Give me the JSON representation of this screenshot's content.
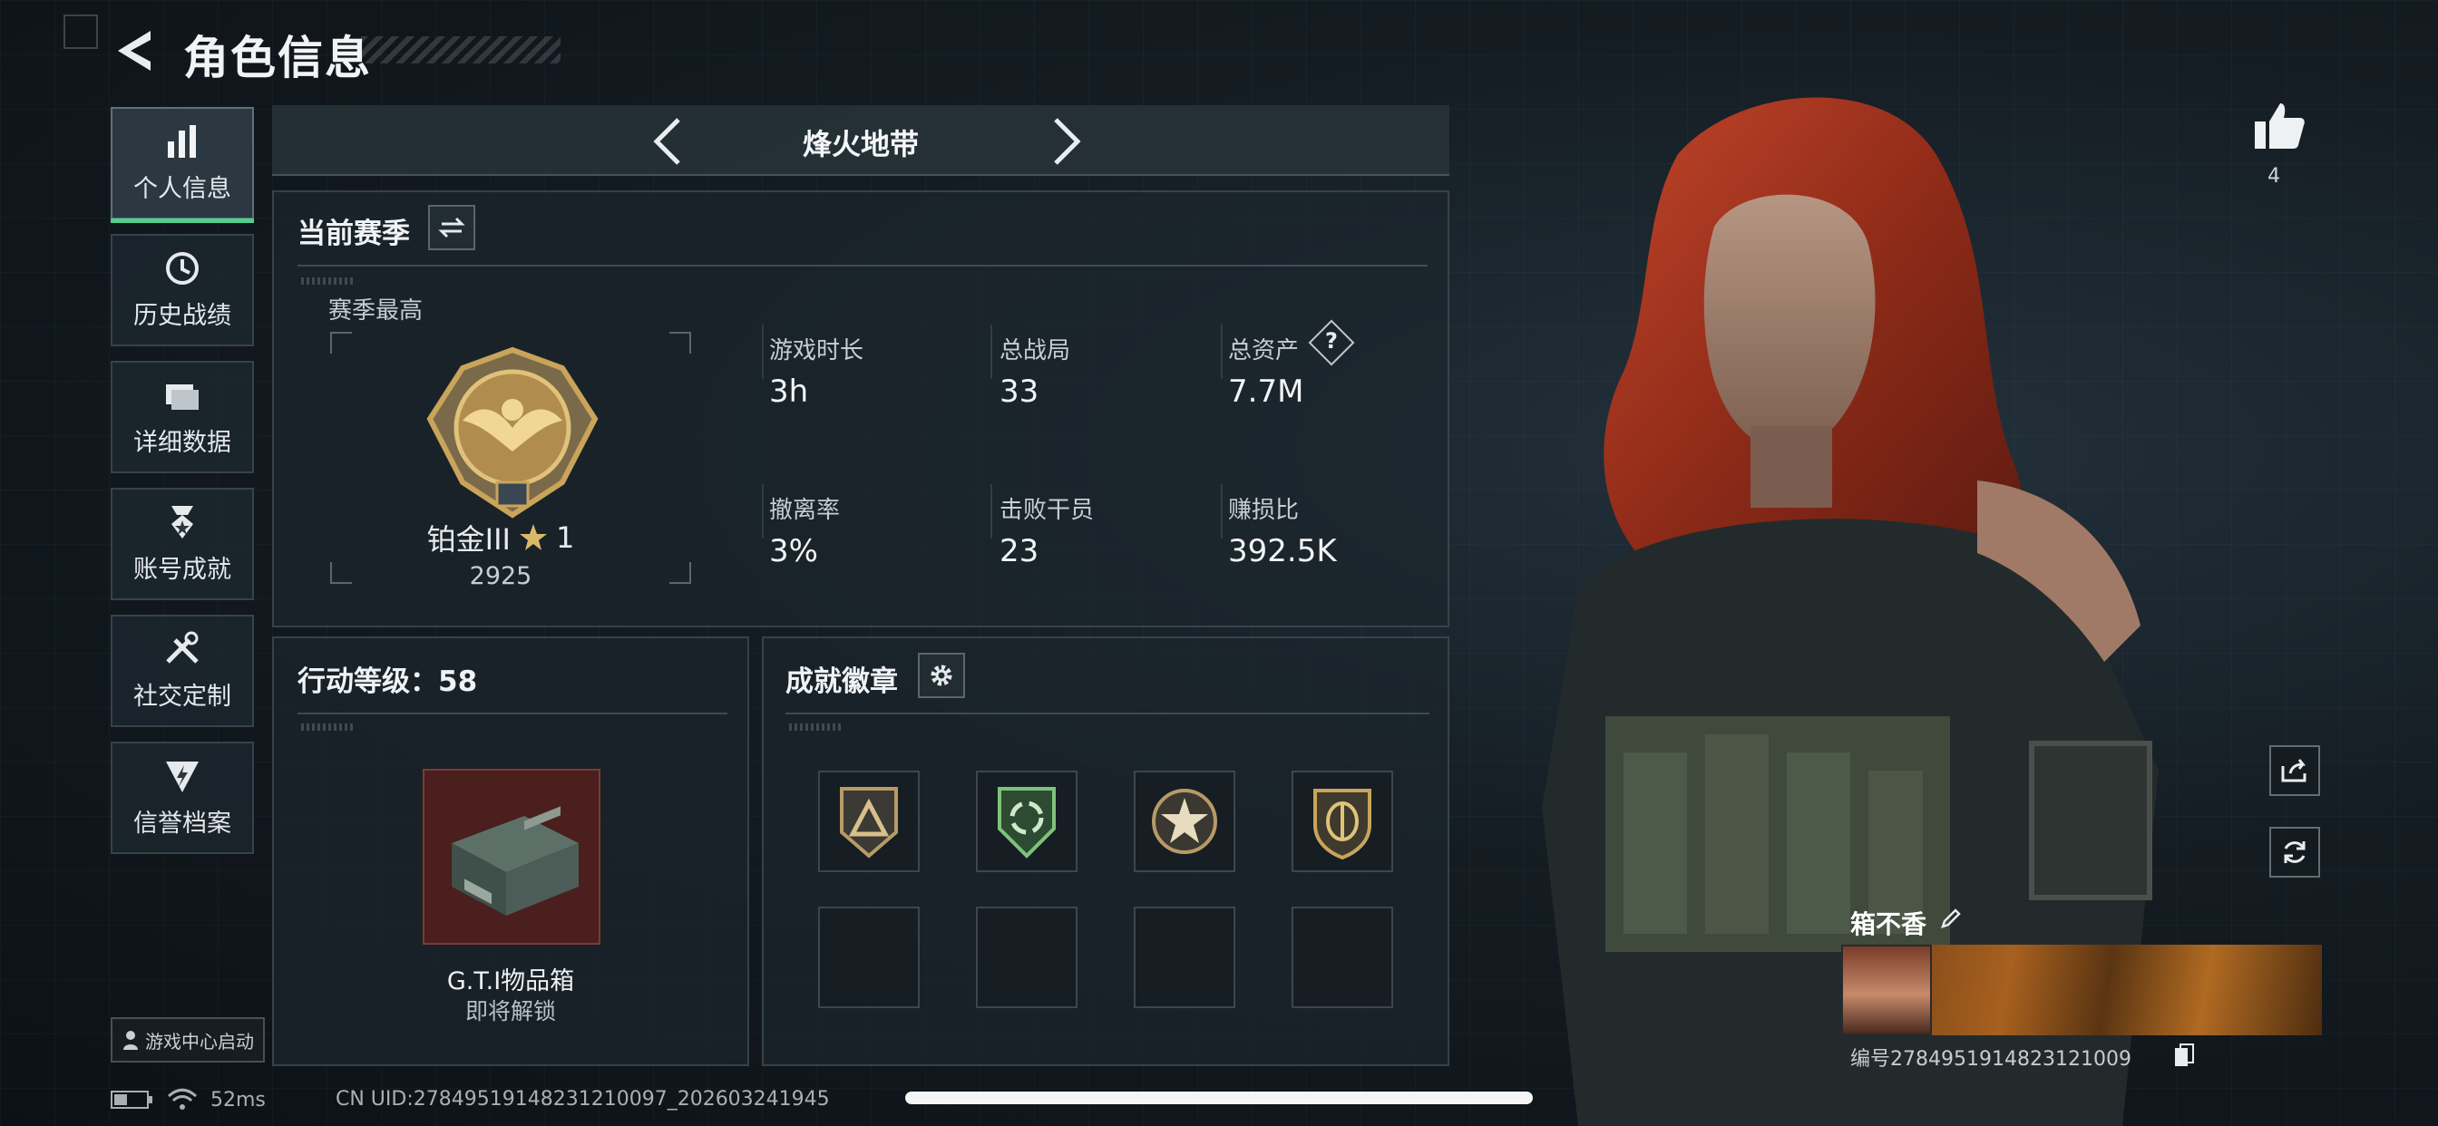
{
  "header": {
    "title": "角色信息"
  },
  "nav": [
    {
      "label": "个人信息",
      "icon": "bar-chart-icon",
      "active": true
    },
    {
      "label": "历史战绩",
      "icon": "history-clock-icon",
      "active": false
    },
    {
      "label": "详细数据",
      "icon": "folder-icon",
      "active": false
    },
    {
      "label": "账号成就",
      "icon": "achievement-medal-icon",
      "active": false
    },
    {
      "label": "社交定制",
      "icon": "tools-icon",
      "active": false
    },
    {
      "label": "信誉档案",
      "icon": "shield-bolt-icon",
      "active": false
    }
  ],
  "launch_label": "游戏中心启动",
  "mode": {
    "title": "烽火地带"
  },
  "season": {
    "title": "当前赛季",
    "best_label": "赛季最高",
    "rank_name": "铂金III",
    "rank_stars": "1",
    "rank_points": "2925",
    "stats": [
      {
        "label": "游戏时长",
        "value": "3h"
      },
      {
        "label": "总战局",
        "value": "33"
      },
      {
        "label": "总资产",
        "value": "7.7M"
      },
      {
        "label": "撤离率",
        "value": "3%"
      },
      {
        "label": "击败干员",
        "value": "23"
      },
      {
        "label": "赚损比",
        "value": "392.5K"
      }
    ],
    "help_symbol": "?"
  },
  "action": {
    "title": "行动等级：58",
    "item_name": "G.T.I物品箱",
    "item_status": "即将解锁"
  },
  "badges": {
    "title": "成就徽章",
    "filled": [
      "triangle-badge",
      "green-arrows-badge",
      "star-badge",
      "shield-badge"
    ]
  },
  "profile": {
    "likes": "4",
    "name": "箱不香",
    "id_text": "编号2784951914823121009"
  },
  "status": {
    "ping": "52ms",
    "uid": "CN UID:2784951914823121009​7_202603241945"
  },
  "colors": {
    "accent": "#4fd08c",
    "gold": "#c9a45a"
  }
}
